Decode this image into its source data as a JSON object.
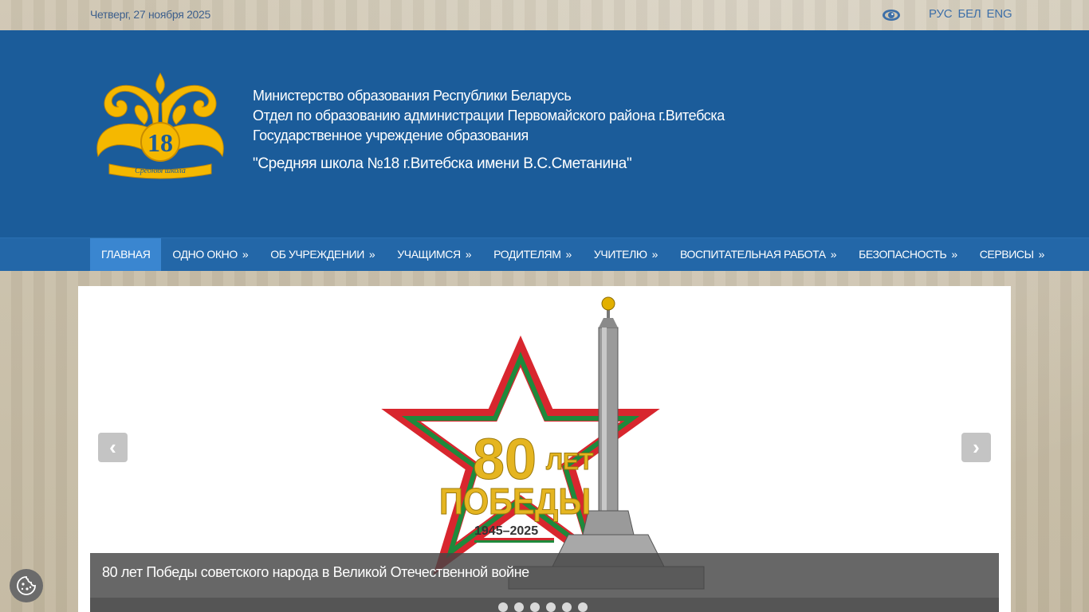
{
  "topbar": {
    "date": "Четверг, 27 ноября 2025",
    "accessibility_icon": "eye-icon",
    "languages": [
      "РУС",
      "БЕЛ",
      "ENG"
    ]
  },
  "header": {
    "logo": {
      "number": "18",
      "ribbon_text": "Средняя школа"
    },
    "lines": [
      "Министерство образования Республики Беларусь",
      "Отдел по образованию администрации Первомайского района г.Витебска",
      "Государственное учреждение образования"
    ],
    "school_name": "\"Средняя школа №18 г.Витебска имени В.С.Сметанина\""
  },
  "nav": {
    "items": [
      {
        "label": "ГЛАВНАЯ",
        "arrow": ""
      },
      {
        "label": "ОДНО ОКНО",
        "arrow": "»"
      },
      {
        "label": "ОБ УЧРЕЖДЕНИИ",
        "arrow": "»"
      },
      {
        "label": "УЧАЩИМСЯ",
        "arrow": "»"
      },
      {
        "label": "РОДИТЕЛЯМ",
        "arrow": "»"
      },
      {
        "label": "УЧИТЕЛЮ",
        "arrow": "»"
      },
      {
        "label": "ВОСПИТАТЕЛЬНАЯ РАБОТА",
        "arrow": "»"
      },
      {
        "label": "БЕЗОПАСНОСТЬ",
        "arrow": "»"
      },
      {
        "label": "СЕРВИСЫ",
        "arrow": "»"
      }
    ]
  },
  "slider": {
    "image": {
      "big_number": "80",
      "small_word": "ЛЕТ",
      "word": "ПОБЕДЫ",
      "years": "1945–2025"
    },
    "caption": "80 лет Победы советского народа в Великой Отечественной войне",
    "prev_symbol": "‹",
    "next_symbol": "›",
    "dot_count": 6
  },
  "colors": {
    "header_bg": "#1b5c9a",
    "nav_bg": "#2367a8",
    "nav_active": "#3a86d0",
    "logo_gold": "#f5b800"
  }
}
